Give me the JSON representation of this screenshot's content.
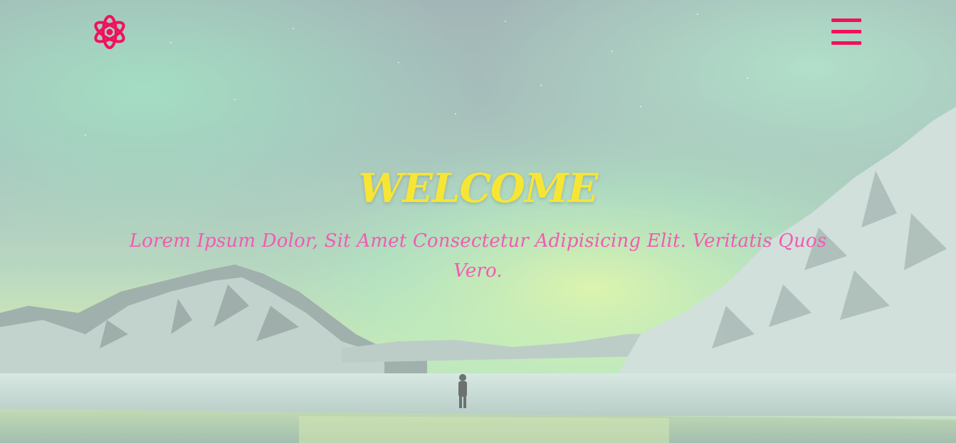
{
  "header": {
    "logo_icon": "atom-icon",
    "menu_icon": "hamburger-menu-icon"
  },
  "hero": {
    "title": "WELCOME",
    "subtitle": "Lorem Ipsum Dolor, Sit Amet Consectetur Adipisicing Elit. Veritatis Quos Vero."
  },
  "colors": {
    "accent": "#f2105e",
    "title": "#f7e536",
    "subtitle": "#f25bb2"
  }
}
